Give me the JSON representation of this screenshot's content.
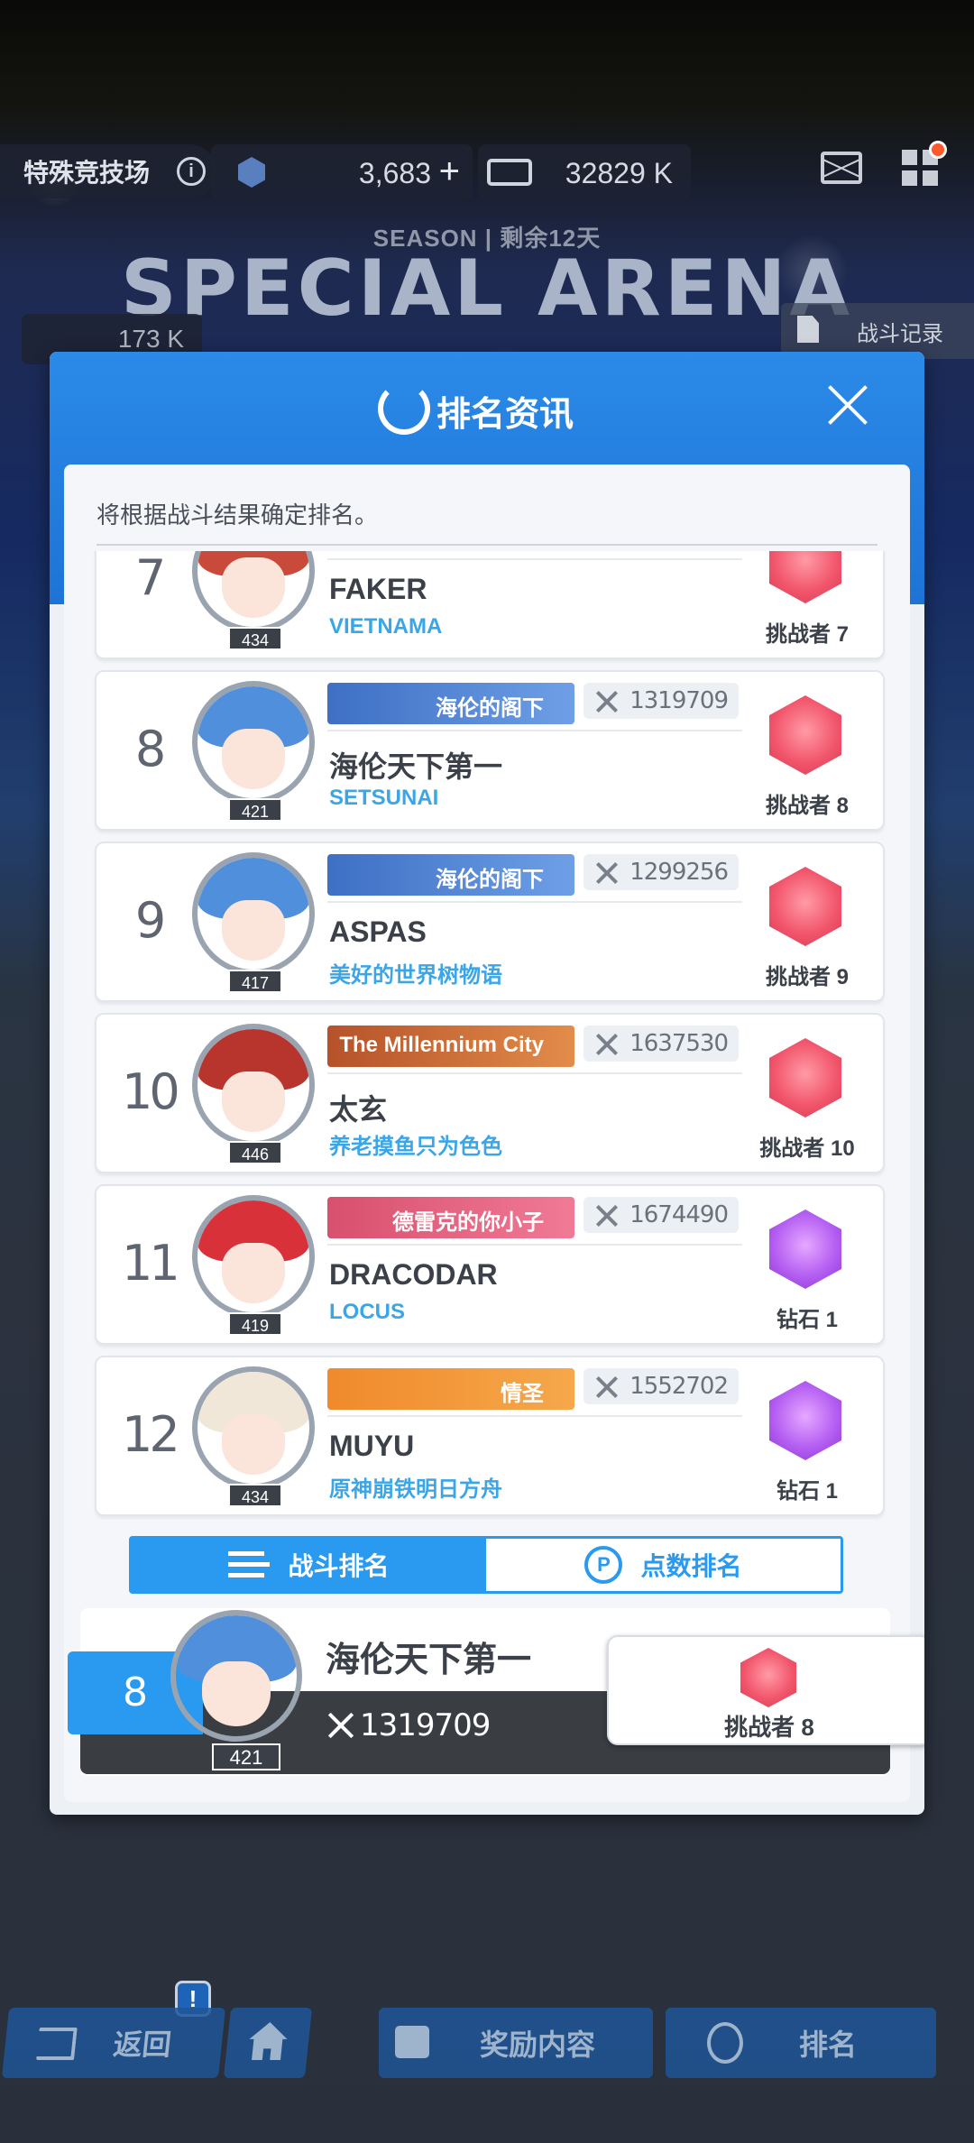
{
  "topbar": {
    "mode_label": "特殊竞技场",
    "currency1": "3,683",
    "currency2": "32829 K",
    "season_label": "SEASON",
    "season_remaining": "剩余12天",
    "arena_title": "SPECIAL ARENA",
    "left_chip_value": "173 K",
    "battle_log_label": "战斗记录"
  },
  "modal": {
    "title": "排名资讯",
    "notice": "将根据战斗结果确定排名。"
  },
  "rows": [
    {
      "rank": "7",
      "level": "434",
      "title": "",
      "power": "",
      "name": "FAKER",
      "guild": "VIETNAMA",
      "tier": "挑战者 7",
      "tier_color": "red",
      "hair": "#c94a3a"
    },
    {
      "rank": "8",
      "level": "421",
      "title": "海伦的阁下",
      "power": "1319709",
      "name": "海伦天下第一",
      "guild": "SETSUNAI",
      "tier": "挑战者 8",
      "tier_color": "red",
      "hair": "#4f8fdc"
    },
    {
      "rank": "9",
      "level": "417",
      "title": "海伦的阁下",
      "power": "1299256",
      "name": "ASPAS",
      "guild": "美好的世界树物语",
      "tier": "挑战者 9",
      "tier_color": "red",
      "hair": "#4f8fdc"
    },
    {
      "rank": "10",
      "level": "446",
      "title": "The Millennium City",
      "power": "1637530",
      "name": "太玄",
      "guild": "养老摸鱼只为色色",
      "tier": "挑战者 10",
      "tier_color": "red",
      "hair": "#b8352d"
    },
    {
      "rank": "11",
      "level": "419",
      "title": "德雷克的你小子",
      "power": "1674490",
      "name": "DRACODAR",
      "guild": "LOCUS",
      "tier": "钻石 1",
      "tier_color": "purple",
      "hair": "#d8313a"
    },
    {
      "rank": "12",
      "level": "434",
      "title": "情圣",
      "power": "1552702",
      "name": "MUYU",
      "guild": "原神崩铁明日方舟",
      "tier": "钻石 1",
      "tier_color": "purple",
      "hair": "#f1e7d8"
    }
  ],
  "tabs": {
    "battle_rank": "战斗排名",
    "points_rank": "点数排名",
    "points_symbol": "P"
  },
  "my_rank": {
    "rank": "8",
    "level": "421",
    "name": "海伦天下第一",
    "power": "1319709",
    "tier": "挑战者 8"
  },
  "bottom": {
    "back": "返回",
    "rewards": "奖励内容",
    "ranking": "排名",
    "alert": "!"
  },
  "colors": {
    "accent_blue": "#2a9af0",
    "guild_blue": "#3aa6e8",
    "challenger_red": "#f2566c",
    "diamond_purple": "#b45ef2"
  }
}
